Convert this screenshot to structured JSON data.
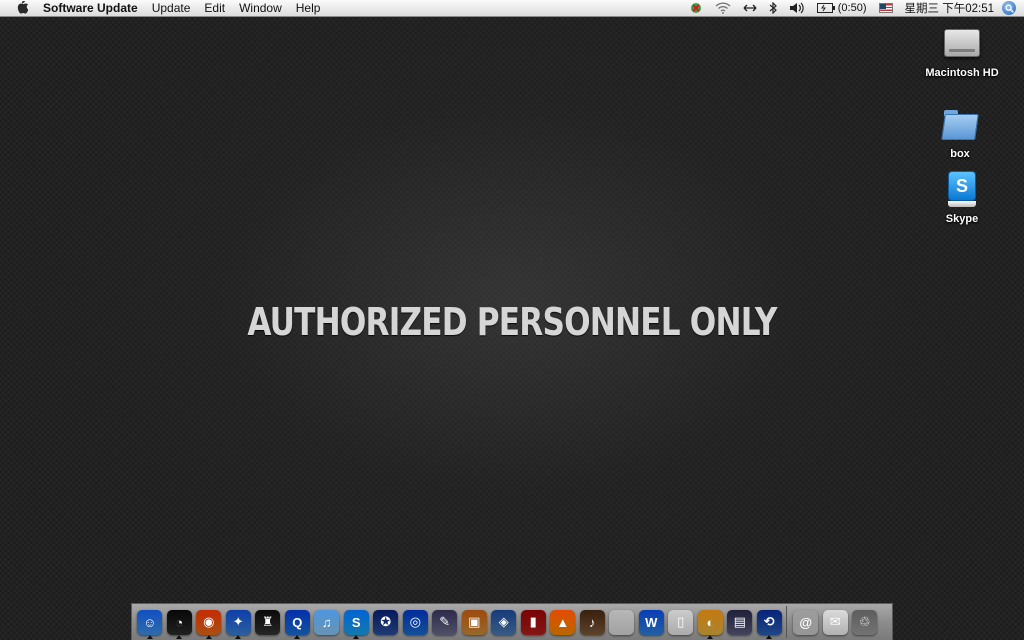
{
  "menubar": {
    "app_name": "Software Update",
    "menus": [
      "Update",
      "Edit",
      "Window",
      "Help"
    ],
    "battery_time": "(0:50)",
    "clock": "星期三 下午02:51"
  },
  "wallpaper": {
    "text": "AUTHORIZED PERSONNEL ONLY"
  },
  "desktop_icons": [
    {
      "label": "Macintosh HD",
      "icon": "hard-drive-icon"
    },
    {
      "label": "box",
      "icon": "folder-icon"
    },
    {
      "label": "Skype",
      "icon": "skype-package-icon"
    }
  ],
  "dock": {
    "apps": [
      {
        "name": "finder-icon",
        "color": "#3f8fe0",
        "glyph": "☺",
        "running": true
      },
      {
        "name": "dashboard-icon",
        "color": "#2b2b2b",
        "glyph": "◔",
        "running": true
      },
      {
        "name": "firefox-icon",
        "color": "#e06a1b",
        "glyph": "◉",
        "running": true
      },
      {
        "name": "safari-icon",
        "color": "#3a7fd0",
        "glyph": "✦",
        "running": true
      },
      {
        "name": "game-icon",
        "color": "#333333",
        "glyph": "♜",
        "running": false
      },
      {
        "name": "quicktime-icon",
        "color": "#1b6fd1",
        "glyph": "Q",
        "running": true
      },
      {
        "name": "itunes-icon",
        "color": "#8cc4ef",
        "glyph": "♫",
        "running": false
      },
      {
        "name": "skype-icon",
        "color": "#1aa0e8",
        "glyph": "S",
        "running": true
      },
      {
        "name": "imovie-icon",
        "color": "#2a4f9a",
        "glyph": "✪",
        "running": false
      },
      {
        "name": "dvd-player-icon",
        "color": "#1a6ac8",
        "glyph": "◎",
        "running": false
      },
      {
        "name": "script-editor-icon",
        "color": "#6a6a8a",
        "glyph": "✎",
        "running": false
      },
      {
        "name": "iphoto-icon",
        "color": "#c98a3a",
        "glyph": "▣",
        "running": false
      },
      {
        "name": "preview-icon",
        "color": "#4a7ab0",
        "glyph": "◈",
        "running": false
      },
      {
        "name": "photo-booth-icon",
        "color": "#b01e1e",
        "glyph": "▮",
        "running": false
      },
      {
        "name": "vlc-icon",
        "color": "#f28a00",
        "glyph": "▲",
        "running": false
      },
      {
        "name": "garageband-icon",
        "color": "#7a5a3a",
        "glyph": "♪",
        "running": false
      },
      {
        "name": "system-preferences-icon",
        "color": "#d8d8d8",
        "glyph": "",
        "running": false
      },
      {
        "name": "wunderlist-icon",
        "color": "#2f7ed8",
        "glyph": "W",
        "running": false
      },
      {
        "name": "ipod-icon",
        "color": "#e4e4e4",
        "glyph": "▯",
        "running": false
      },
      {
        "name": "disk-utility-icon",
        "color": "#e0b040",
        "glyph": "◐",
        "running": true
      },
      {
        "name": "photos-icon",
        "color": "#5a5a7a",
        "glyph": "▤",
        "running": false
      },
      {
        "name": "time-machine-icon",
        "color": "#2a5fb0",
        "glyph": "⟲",
        "running": true
      }
    ],
    "docs": [
      {
        "name": "downloads-stack-icon",
        "color": "#c8c8c8",
        "glyph": "@"
      },
      {
        "name": "mail-stack-icon",
        "color": "#ececec",
        "glyph": "✉"
      },
      {
        "name": "trash-icon",
        "color": "#9a9a9a",
        "glyph": "♲"
      }
    ]
  }
}
